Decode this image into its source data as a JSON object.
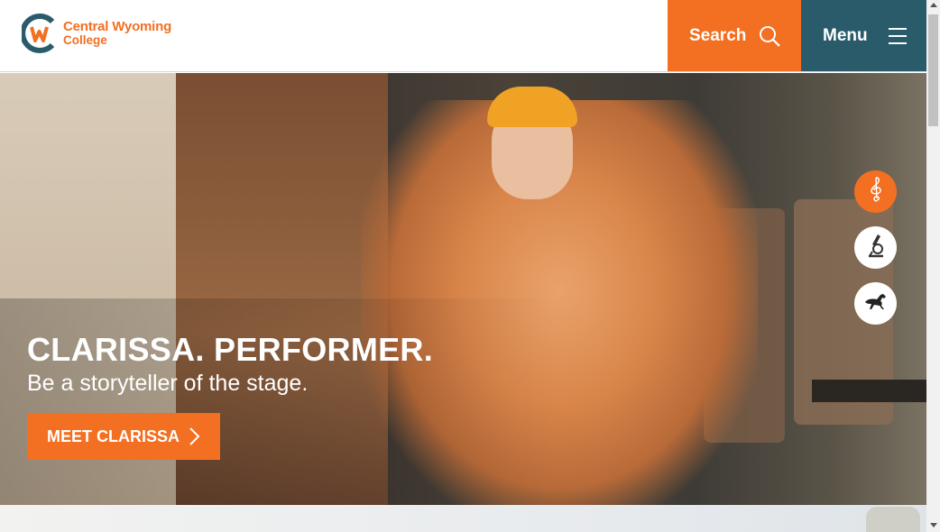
{
  "header": {
    "logo_line1": "Central Wyoming",
    "logo_line2": "College",
    "search_label": "Search",
    "menu_label": "Menu"
  },
  "hero": {
    "title": "CLARISSA. PERFORMER.",
    "subtitle": "Be a storyteller of the stage.",
    "cta_label": "MEET CLARISSA"
  },
  "side_nav": [
    {
      "icon": "treble-clef-icon",
      "active": true
    },
    {
      "icon": "microscope-icon",
      "active": false
    },
    {
      "icon": "horse-icon",
      "active": false
    }
  ],
  "colors": {
    "accent": "#f36f21",
    "menu": "#2a5b6b"
  }
}
